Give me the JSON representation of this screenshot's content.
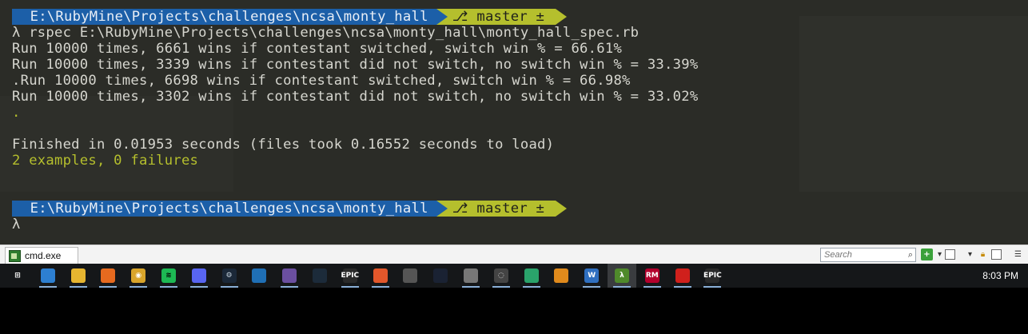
{
  "terminal": {
    "prompt1": {
      "path": " E:\\RubyMine\\Projects\\challenges\\ncsa\\monty_hall",
      "branch": "master ±",
      "branch_icon": "git-branch-icon"
    },
    "lines": [
      "λ rspec E:\\RubyMine\\Projects\\challenges\\ncsa\\monty_hall\\monty_hall_spec.rb",
      "Run 10000 times, 6661 wins if contestant switched, switch win % = 66.61%",
      "Run 10000 times, 3339 wins if contestant did not switch, no switch win % = 33.39%",
      ".Run 10000 times, 6698 wins if contestant switched, switch win % = 66.98%",
      "Run 10000 times, 3302 wins if contestant did not switch, no switch win % = 33.02%",
      ".",
      "",
      "Finished in 0.01953 seconds (files took 0.16552 seconds to load)",
      "2 examples, 0 failures"
    ],
    "prompt2": {
      "path": " E:\\RubyMine\\Projects\\challenges\\ncsa\\monty_hall",
      "branch": "master ±",
      "branch_icon": "git-branch-icon"
    },
    "cursor_line": "λ",
    "colors": {
      "background": "#2b2c27",
      "text": "#d6d6cf",
      "green": "#b5bf2d",
      "path_bg": "#1c5fa8"
    }
  },
  "statusbar": {
    "tab_label": "cmd.exe",
    "tab_icon": "cmd-icon",
    "search_placeholder": "Search",
    "icons": [
      "search-icon",
      "add-tab-icon",
      "dropdown-icon",
      "panel-icon",
      "dropdown-icon",
      "lock-icon",
      "split-view-icon",
      "menu-icon"
    ]
  },
  "taskbar": {
    "clock": "8:03 PM",
    "apps": [
      {
        "name": "windows-start",
        "label": ""
      },
      {
        "name": "desktop",
        "label": ""
      },
      {
        "name": "file-explorer",
        "label": ""
      },
      {
        "name": "firefox",
        "label": ""
      },
      {
        "name": "chrome",
        "label": ""
      },
      {
        "name": "spotify",
        "label": ""
      },
      {
        "name": "discord",
        "label": ""
      },
      {
        "name": "steam",
        "label": ""
      },
      {
        "name": "app-blue",
        "label": ""
      },
      {
        "name": "origin-gg",
        "label": ""
      },
      {
        "name": "league",
        "label": ""
      },
      {
        "name": "epic-games",
        "label": "EPIC"
      },
      {
        "name": "app-orange",
        "label": ""
      },
      {
        "name": "app-grey",
        "label": ""
      },
      {
        "name": "app-dark",
        "label": ""
      },
      {
        "name": "app-skull",
        "label": ""
      },
      {
        "name": "app-circle",
        "label": ""
      },
      {
        "name": "app-green",
        "label": ""
      },
      {
        "name": "app-fl",
        "label": ""
      },
      {
        "name": "app-w",
        "label": "W"
      },
      {
        "name": "cmder",
        "label": "λ"
      },
      {
        "name": "rubymine",
        "label": "RM"
      },
      {
        "name": "acrobat",
        "label": ""
      },
      {
        "name": "epic-games-2",
        "label": "EPIC"
      }
    ]
  }
}
